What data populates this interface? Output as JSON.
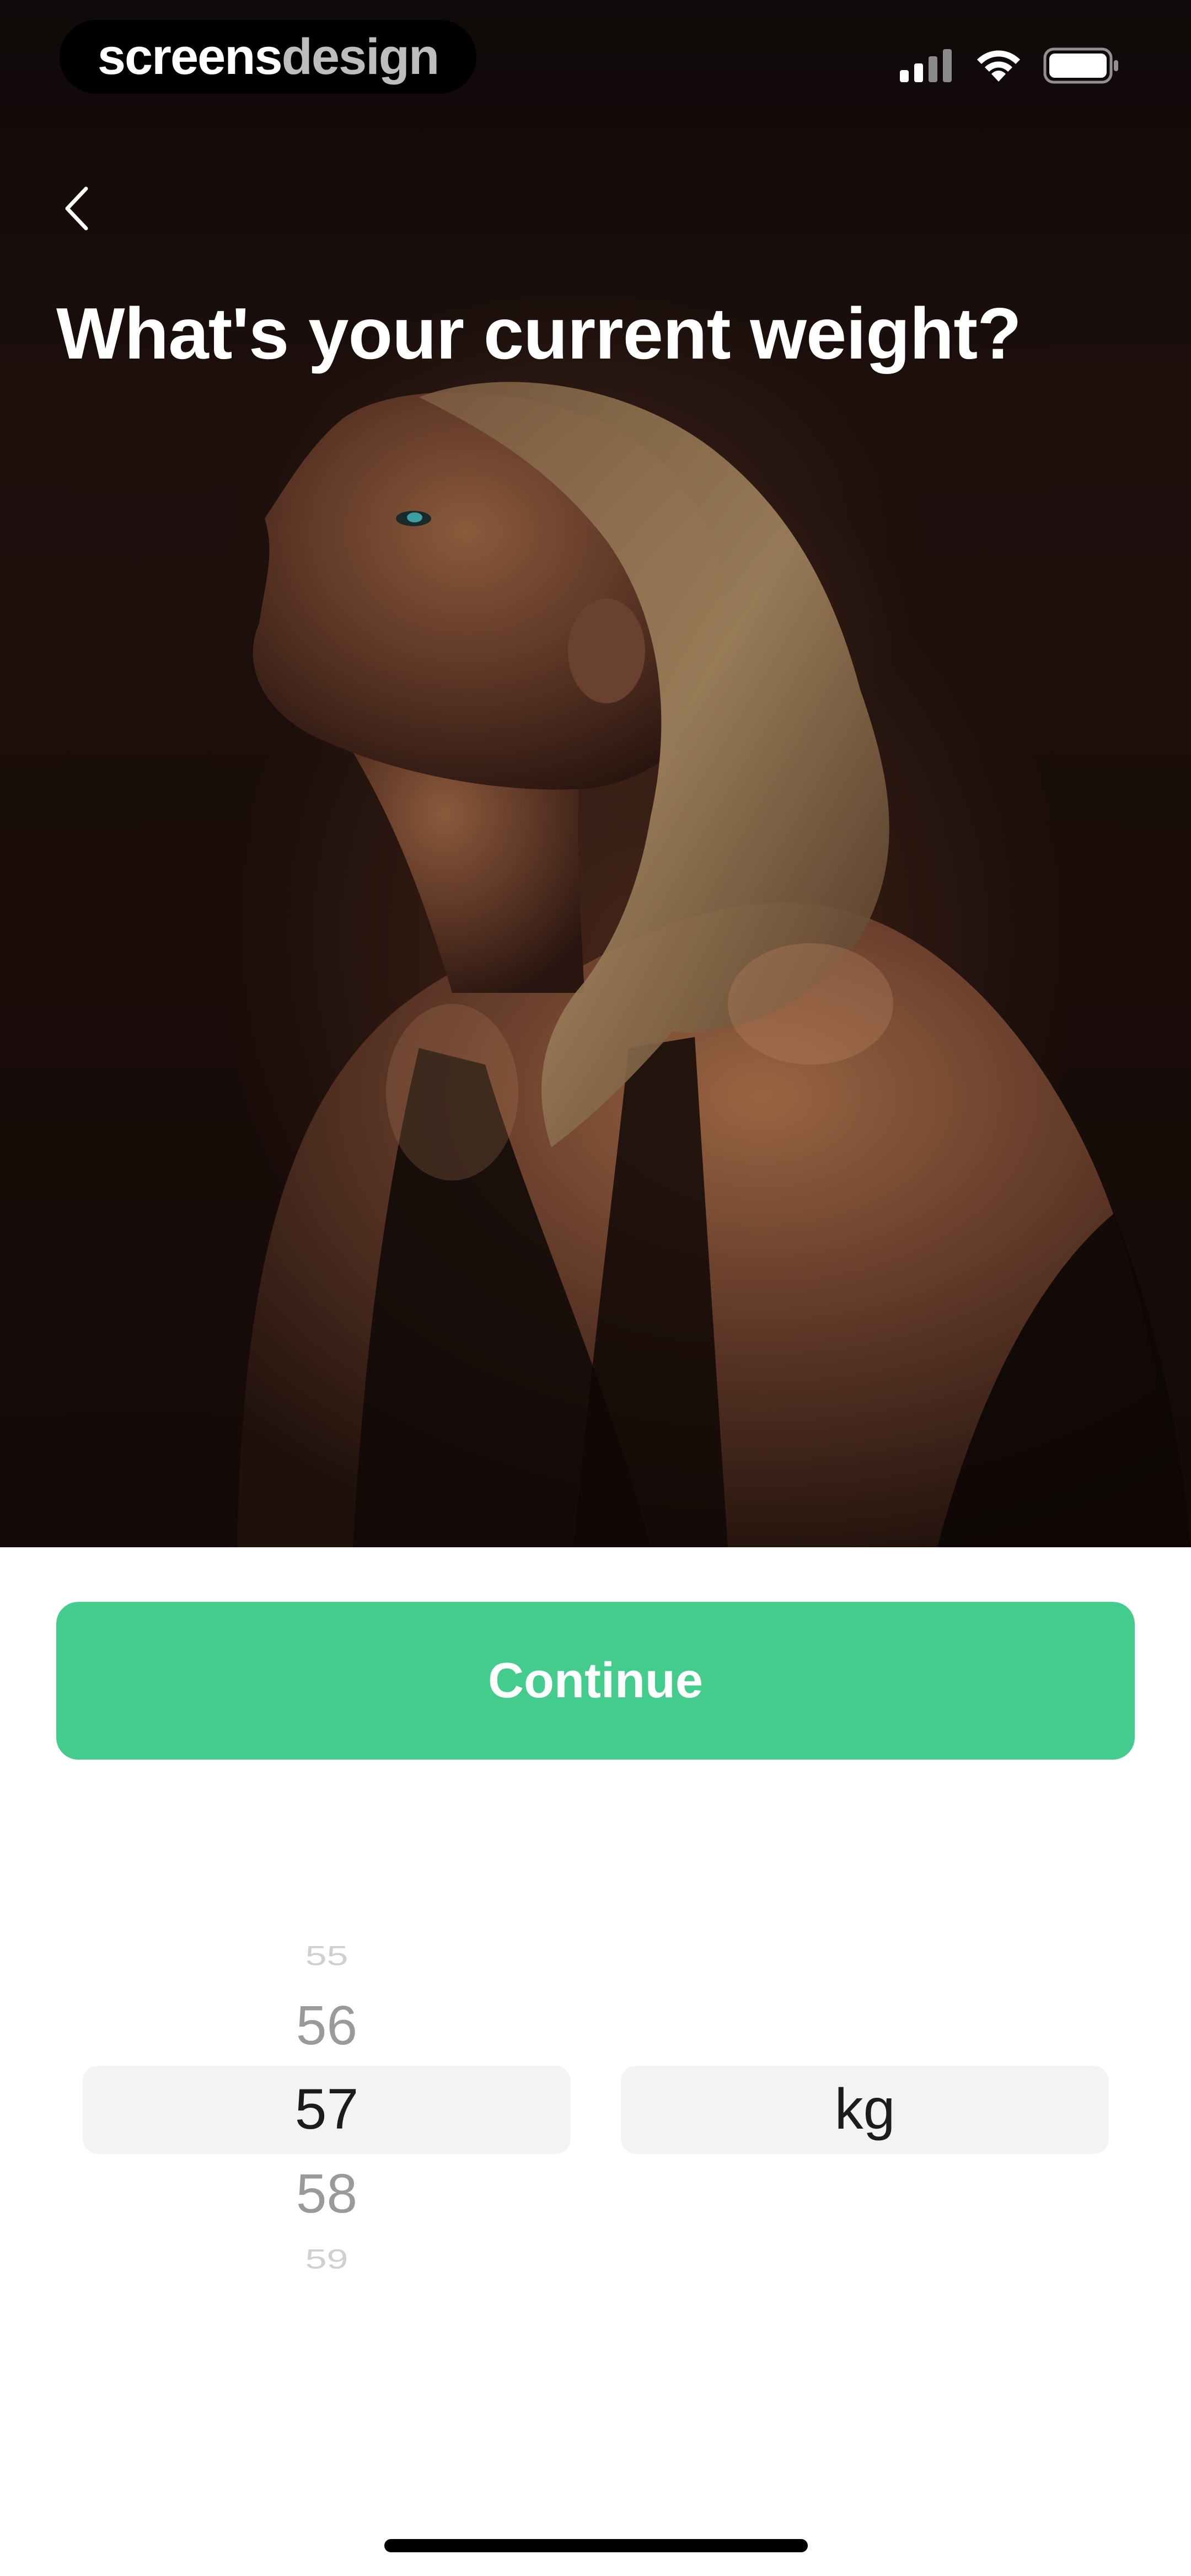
{
  "status_bar": {
    "brand_part1": "screens",
    "brand_part2": "design",
    "icons": [
      "cellular-signal-icon",
      "wifi-icon",
      "battery-icon"
    ]
  },
  "header": {
    "back_icon": "chevron-left-icon",
    "title": "What's your current weight?"
  },
  "continue_label": "Continue",
  "weight_picker": {
    "values": [
      "55",
      "56",
      "57",
      "58",
      "59"
    ],
    "selected": "57",
    "unit_options": [
      "kg"
    ],
    "selected_unit": "kg"
  },
  "colors": {
    "accent": "#43cc8c",
    "picker_highlight": "#f3f3f5",
    "title_text": "#ffffff"
  }
}
